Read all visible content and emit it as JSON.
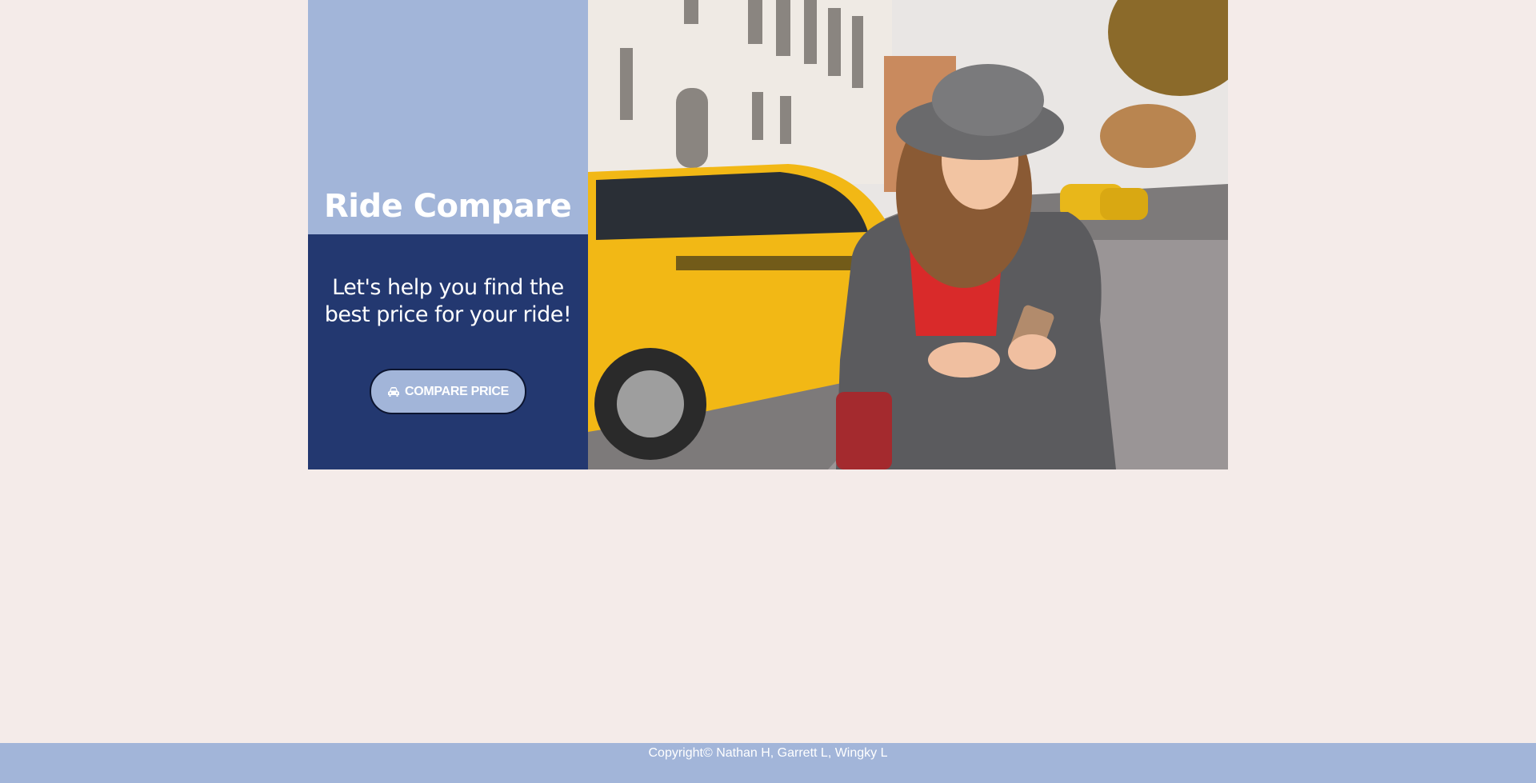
{
  "brand": {
    "title": "Ride Compare"
  },
  "hero": {
    "tagline": "Let's help you find the best price for your ride!",
    "button_label": "COMPARE PRICE",
    "button_icon": "car-icon",
    "image_alt": "woman-with-phone-and-taxi-photo"
  },
  "footer": {
    "copyright": "Copyright© Nathan H, Garrett L, Wingky L"
  },
  "colors": {
    "page_background": "#f4ebe9",
    "brand_panel": "#a2b5d9",
    "cta_panel": "#233870",
    "button_background": "#a2b5d9",
    "footer_background": "#a2b5d9"
  }
}
